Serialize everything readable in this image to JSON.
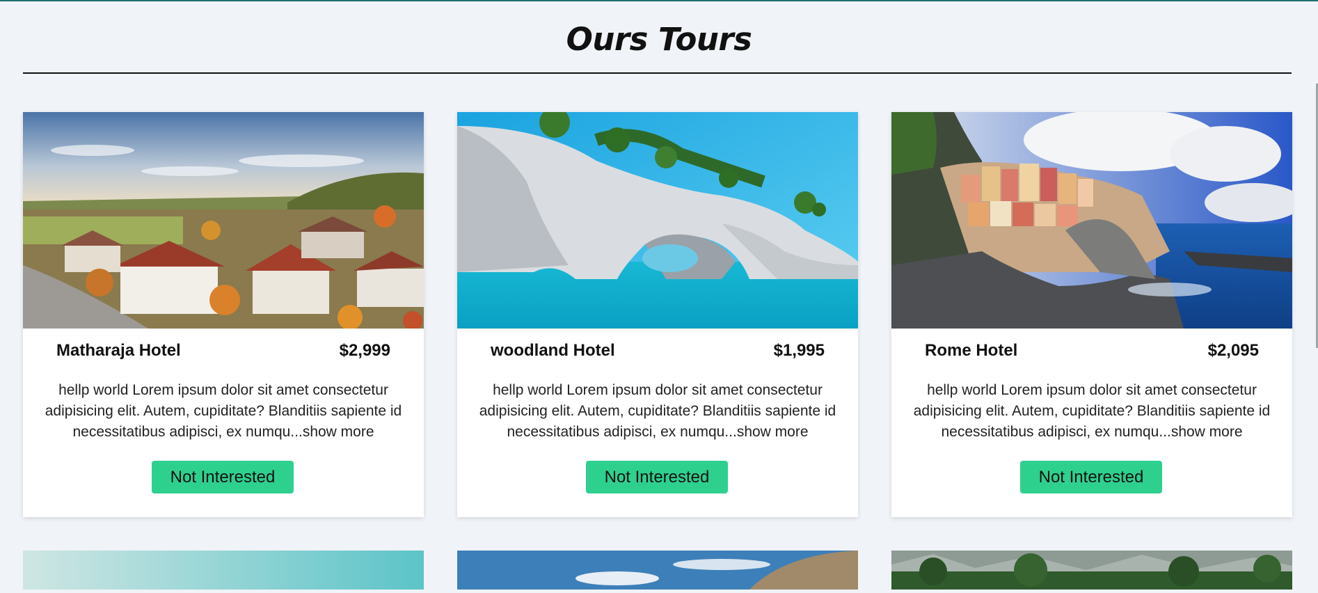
{
  "page": {
    "heading": "Ours Tours"
  },
  "tours": [
    {
      "name": "Matharaja Hotel",
      "price": "$2,999",
      "description": "hellp world Lorem ipsum dolor sit amet consectetur adipisicing elit. Autem, cupiditate? Blanditiis sapiente id necessitatibus adipisci, ex numqu...",
      "show_more": "show more",
      "button": "Not Interested",
      "image": "village-autumn"
    },
    {
      "name": "woodland Hotel",
      "price": "$1,995",
      "description": "hellp world Lorem ipsum dolor sit amet consectetur adipisicing elit. Autem, cupiditate? Blanditiis sapiente id necessitatibus adipisci, ex numqu...",
      "show_more": "show more",
      "button": "Not Interested",
      "image": "sea-arch"
    },
    {
      "name": "Rome Hotel",
      "price": "$2,095",
      "description": "hellp world Lorem ipsum dolor sit amet consectetur adipisicing elit. Autem, cupiditate? Blanditiis sapiente id necessitatibus adipisci, ex numqu...",
      "show_more": "show more",
      "button": "Not Interested",
      "image": "coastal-village"
    }
  ],
  "colors": {
    "accent": "#2ed08e",
    "background": "#f0f3f7"
  }
}
